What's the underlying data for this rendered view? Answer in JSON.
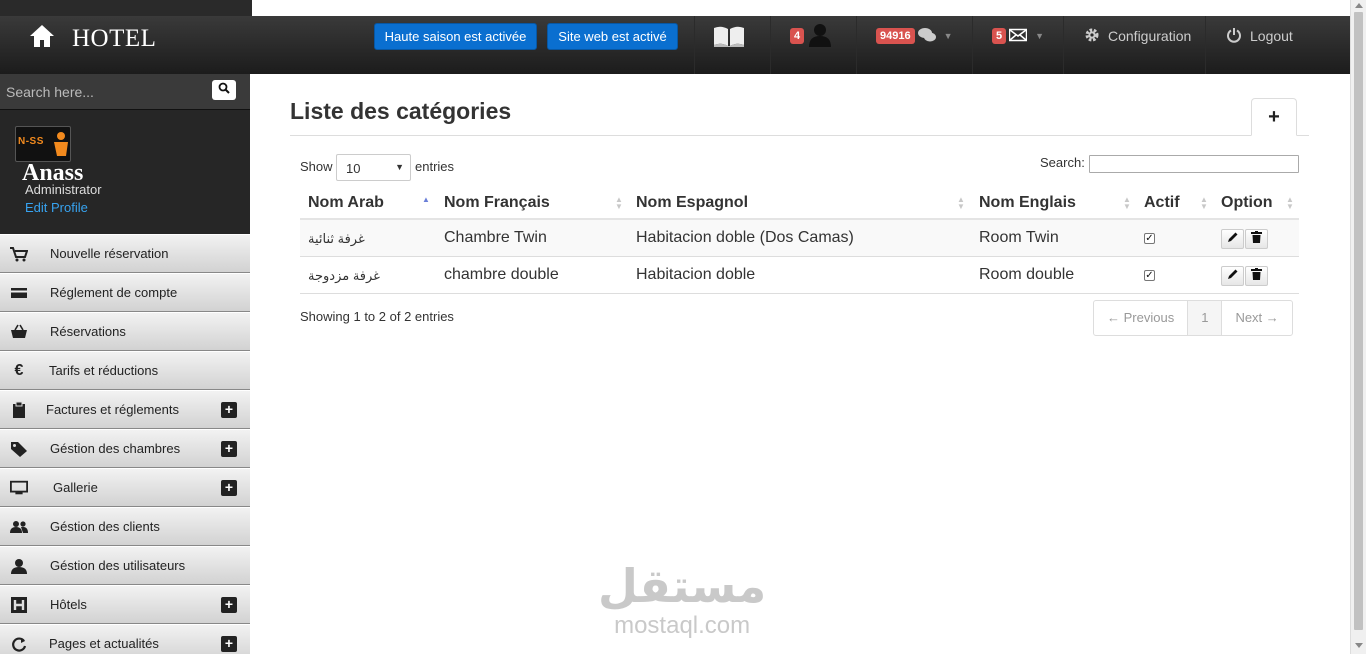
{
  "app": {
    "title": "HOTEL"
  },
  "header": {
    "season_button": "Haute saison est activée",
    "website_button": "Site web est activé",
    "users_badge": "4",
    "messages_badge": "94916",
    "mail_badge": "5",
    "config_label": "Configuration",
    "logout_label": "Logout"
  },
  "sidebar": {
    "search": {
      "placeholder": "Search here..."
    },
    "profile": {
      "logo_text": "N-SS",
      "name": "Anass",
      "role": "Administrator",
      "edit_label": "Edit Profile"
    },
    "items": [
      {
        "label": "Nouvelle réservation",
        "icon": "cart-icon",
        "expandable": false
      },
      {
        "label": "Réglement de compte",
        "icon": "credit-card-icon",
        "expandable": false
      },
      {
        "label": "Réservations",
        "icon": "basket-icon",
        "expandable": false
      },
      {
        "label": "Tarifs et réductions",
        "icon": "euro-icon",
        "expandable": false
      },
      {
        "label": "Factures et réglements",
        "icon": "clipboard-icon",
        "expandable": true
      },
      {
        "label": "Géstion des chambres",
        "icon": "tag-icon",
        "expandable": true
      },
      {
        "label": "Gallerie",
        "icon": "monitor-icon",
        "expandable": true
      },
      {
        "label": "Géstion des clients",
        "icon": "users-icon",
        "expandable": false
      },
      {
        "label": "Géstion des utilisateurs",
        "icon": "user-icon",
        "expandable": false
      },
      {
        "label": "Hôtels",
        "icon": "hotel-icon",
        "expandable": true
      },
      {
        "label": "Pages et actualités",
        "icon": "refresh-icon",
        "expandable": true
      }
    ]
  },
  "main": {
    "title": "Liste des catégories",
    "add_tab": "+",
    "length": {
      "show": "Show",
      "value": "10",
      "entries": "entries"
    },
    "search_label": "Search:",
    "columns": [
      "Nom Arab",
      "Nom Français",
      "Nom Espagnol",
      "Nom Englais",
      "Actif",
      "Option"
    ],
    "rows": [
      {
        "ar": "غرفة ثنائية",
        "fr": "Chambre Twin",
        "es": "Habitacion doble (Dos Camas)",
        "en": "Room Twin",
        "active": true
      },
      {
        "ar": "غرفة مزدوجة",
        "fr": "chambre double",
        "es": "Habitacion doble",
        "en": "Room double",
        "active": true
      }
    ],
    "info": "Showing 1 to 2 of 2 entries",
    "pagination": {
      "prev": "← Previous",
      "page": "1",
      "next": "Next →"
    }
  },
  "watermark": {
    "arabic": "مستقل",
    "latin": "mostaql.com"
  }
}
